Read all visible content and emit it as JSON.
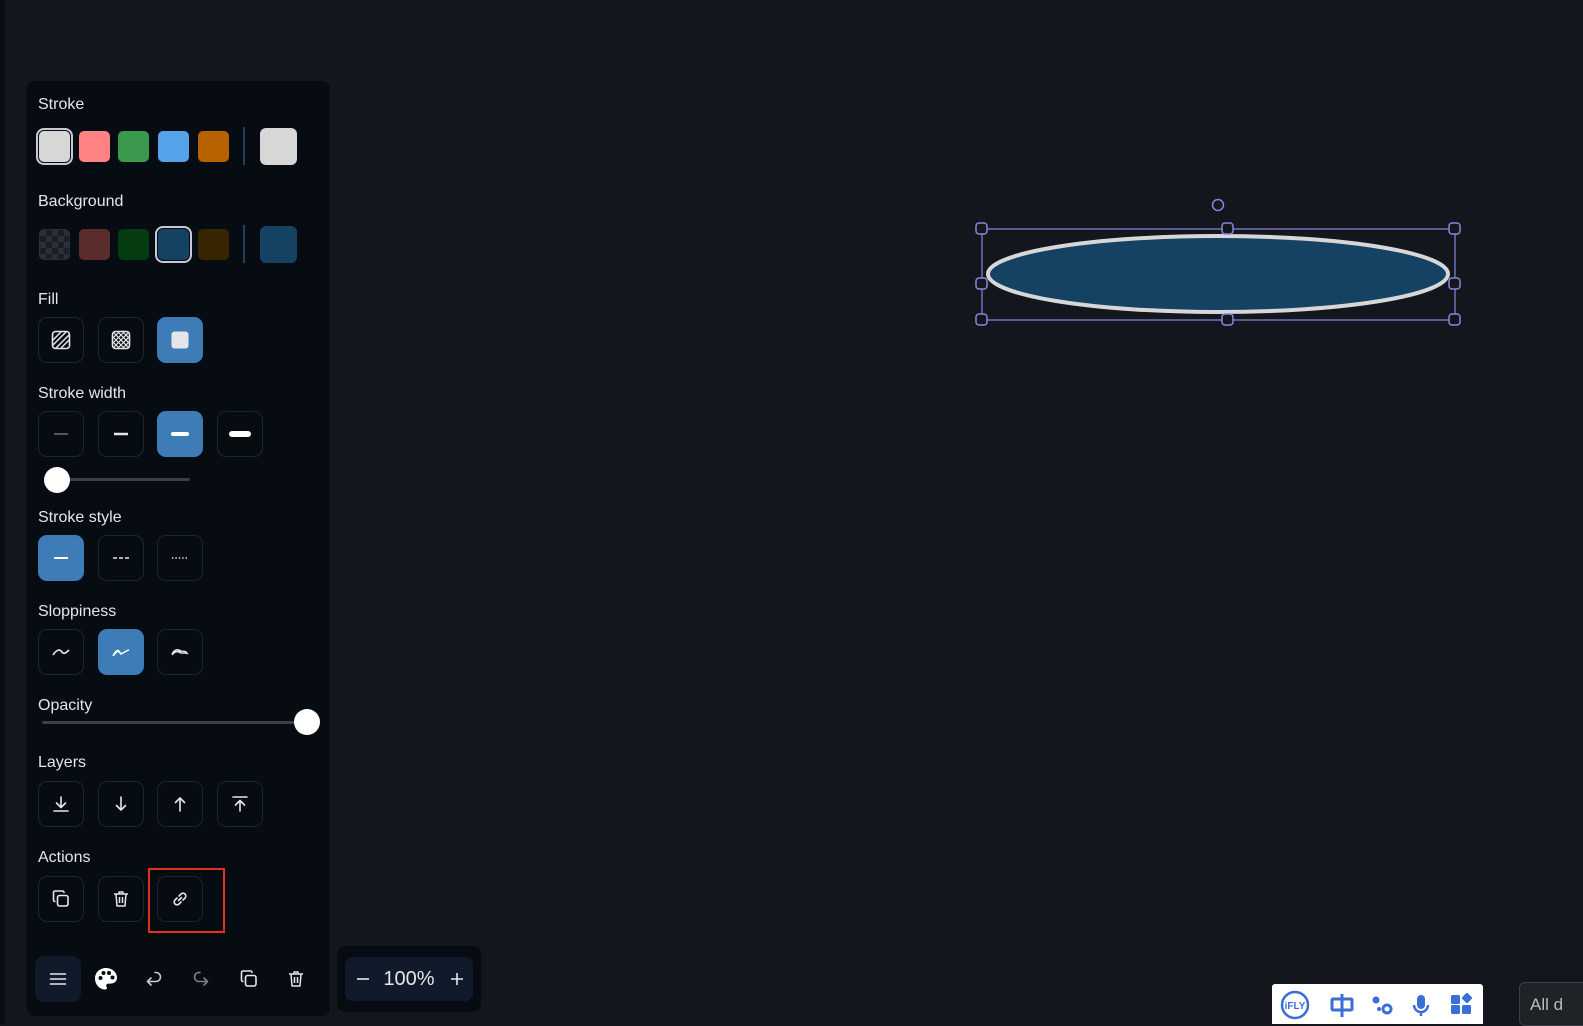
{
  "panel": {
    "stroke": {
      "label": "Stroke",
      "swatches": [
        "#d7d7d7",
        "#ff8383",
        "#3a994c",
        "#56a2e8",
        "#b76100"
      ],
      "selected_index": 0,
      "current_color": "#d7d7d7"
    },
    "background": {
      "label": "Background",
      "swatches": [
        "transparent",
        "#5b2c2c",
        "#053b10",
        "#154163",
        "#362500"
      ],
      "selected_index": 3,
      "current_color": "#154163"
    },
    "fill": {
      "label": "Fill",
      "options": [
        "hachure-fill-icon",
        "cross-hatch-fill-icon",
        "solid-fill-icon"
      ],
      "selected": "solid-fill-icon"
    },
    "stroke_width": {
      "label": "Stroke width",
      "options": [
        "thin-stroke-icon",
        "bold-stroke-icon",
        "extra-bold-stroke-icon",
        "custom-stroke-icon"
      ],
      "selected": "extra-bold-stroke-icon",
      "slider_value": 0
    },
    "stroke_style": {
      "label": "Stroke style",
      "options": [
        "solid-line-icon",
        "dashed-line-icon",
        "dotted-line-icon"
      ],
      "selected": "solid-line-icon"
    },
    "sloppiness": {
      "label": "Sloppiness",
      "options": [
        "architect-icon",
        "artist-icon",
        "cartoonist-icon"
      ],
      "selected": "artist-icon"
    },
    "opacity": {
      "label": "Opacity",
      "value": 100
    },
    "layers": {
      "label": "Layers",
      "options": [
        "send-to-back-icon",
        "send-backward-icon",
        "bring-forward-icon",
        "bring-to-front-icon"
      ]
    },
    "actions": {
      "label": "Actions",
      "options": [
        "duplicate-icon",
        "delete-icon",
        "link-icon"
      ]
    }
  },
  "toolbar": {
    "buttons": [
      "menu-icon",
      "palette-icon",
      "undo-icon",
      "redo-icon",
      "duplicate-icon",
      "delete-icon"
    ]
  },
  "zoom": {
    "value": "100%"
  },
  "ifly_bar": {
    "icons": [
      "ifly-logo-icon",
      "chinese-input-icon",
      "share-icon",
      "microphone-icon",
      "apps-grid-icon"
    ],
    "accent": "#3a6fd8"
  },
  "corner_tag": {
    "text": "All d"
  },
  "canvas": {
    "ellipse_fill": "#154163",
    "ellipse_stroke": "#d7d7d7",
    "selection_color": "#8a86e0"
  }
}
